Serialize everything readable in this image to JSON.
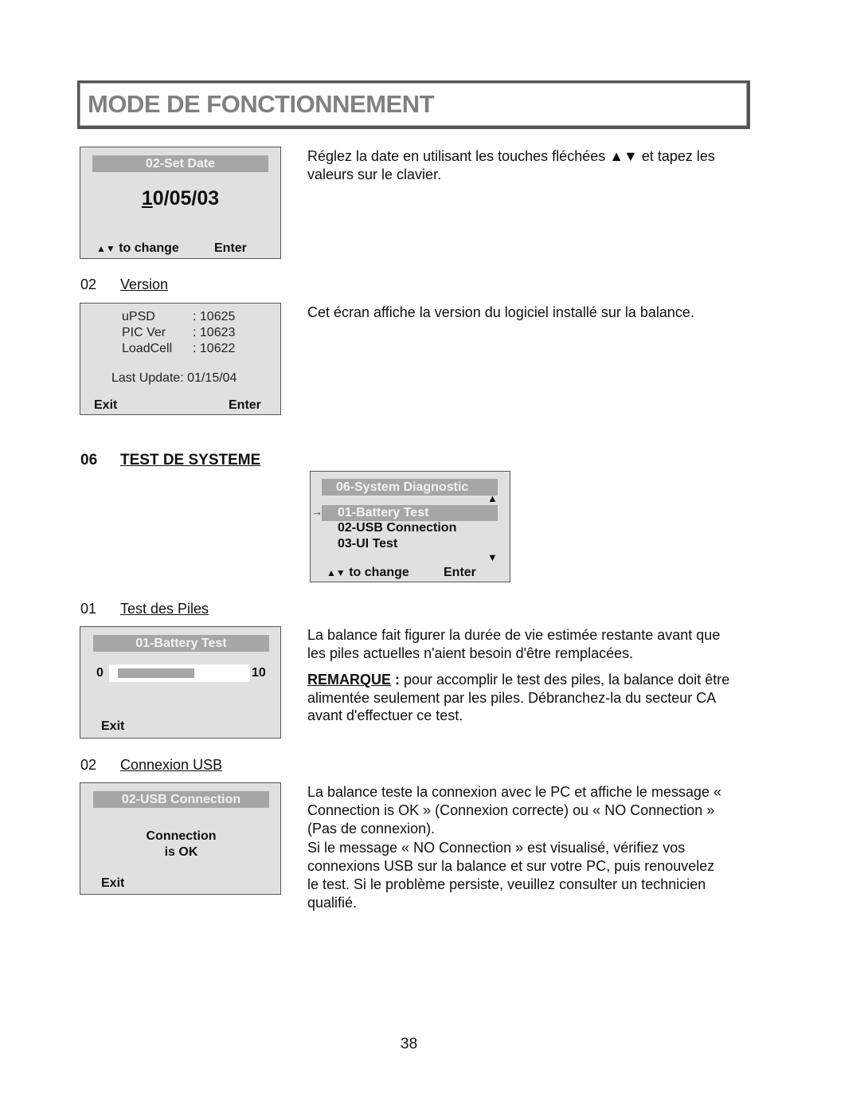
{
  "header": {
    "title": "MODE DE FONCTIONNEMENT"
  },
  "set_date": {
    "screen": {
      "title": "02-Set Date",
      "date_first_digit": "1",
      "date_rest": "0/05/03",
      "footer_arrows": "▲▼",
      "footer_left": "to change",
      "footer_right": "Enter"
    },
    "description": "Réglez la date en utilisant les touches fléchées ▲▼ et tapez les valeurs sur le clavier."
  },
  "version": {
    "section_number": "02",
    "section_name": "Version",
    "screen": {
      "rows": [
        {
          "label": "uPSD",
          "value": ": 10625"
        },
        {
          "label": "PIC Ver",
          "value": ": 10623"
        },
        {
          "label": "LoadCell",
          "value": ": 10622"
        }
      ],
      "last_update": "Last Update: 01/15/04",
      "footer_left": "Exit",
      "footer_right": "Enter"
    },
    "description": "Cet écran affiche la version du logiciel installé sur la balance."
  },
  "system_test": {
    "section_number": "06",
    "section_name": "TEST DE SYSTEME",
    "screen": {
      "title": "06-System Diagnostic",
      "pointer": "→",
      "items": [
        "01-Battery Test",
        "02-USB Connection",
        "03-UI Test"
      ],
      "selected_index": 0,
      "scroll_up": "▲",
      "scroll_down": "▼",
      "footer_arrows": "▲▼",
      "footer_left": "to change",
      "footer_right": "Enter"
    }
  },
  "battery_test": {
    "section_number": "01",
    "section_name": "Test des Piles",
    "screen": {
      "title": "01-Battery Test",
      "scale_min": "0",
      "scale_max": "10",
      "level_fraction": 0.62,
      "footer_left": "Exit"
    },
    "description": "La balance fait figurer la durée de vie estimée restante avant que les piles actuelles n'aient besoin d'être remplacées.",
    "remark_label": "REMARQUE",
    "remark_colon": " :",
    "remark_text": " pour accomplir le test des piles, la balance doit être alimentée seulement par les piles. Débranchez-la du secteur CA avant d'effectuer ce test."
  },
  "usb_test": {
    "section_number": "02",
    "section_name": "Connexion USB",
    "screen": {
      "title": "02-USB Connection",
      "message_line1": "Connection",
      "message_line2": "is OK",
      "footer_left": "Exit"
    },
    "description_p1": "La balance teste la connexion avec le PC et affiche le message « Connection is OK » (Connexion correcte) ou « NO Connection » (Pas de connexion).",
    "description_p2": "Si le message « NO Connection » est visualisé, vérifiez vos connexions USB sur  la balance et sur votre PC, puis renouvelez le test. Si le problème persiste, veuillez consulter un technicien qualifié."
  },
  "footer": {
    "page_number": "38"
  }
}
